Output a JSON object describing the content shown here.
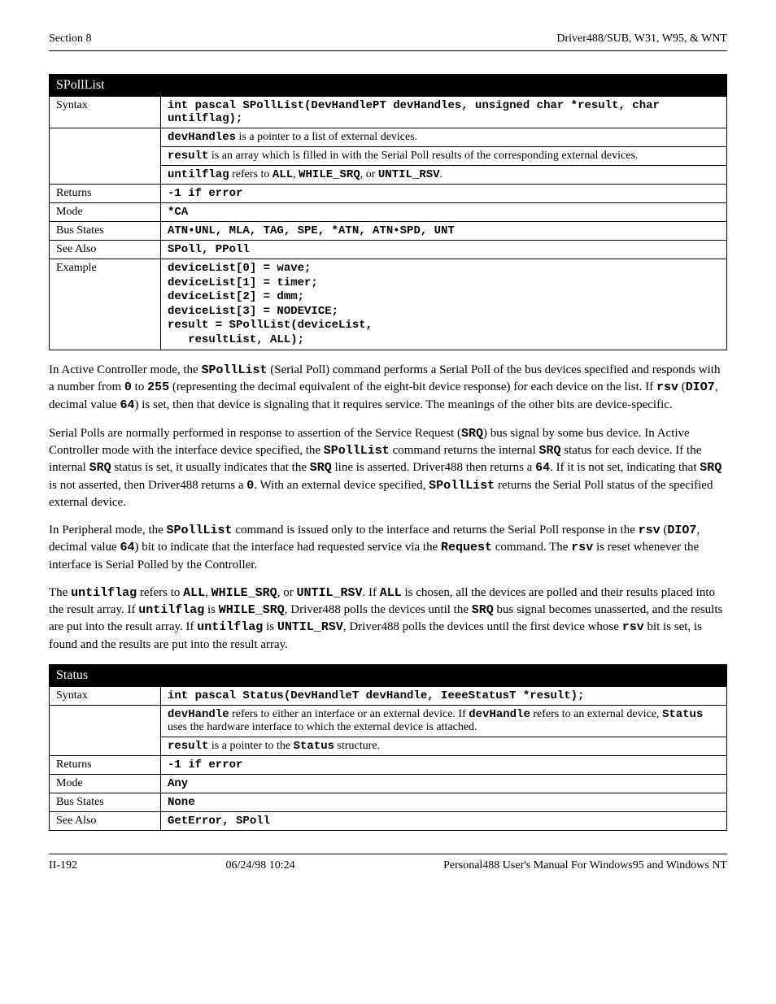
{
  "header": {
    "left": "Section 8",
    "right": "Driver488/SUB, W31, W95, & WNT"
  },
  "table1": {
    "title": "SPollList",
    "rows": {
      "syntax_label": "Syntax",
      "syntax_val": "int pascal SPollList(DevHandlePT devHandles, unsigned char *result, char untilflag);",
      "devh_label": "devHandles",
      "devh_after": " is a pointer to a list of external devices.",
      "result_label": "result",
      "result_after": " is an array which is filled in with the Serial Poll results of the corresponding external devices.",
      "until_label": "untilflag",
      "until_mid": " refers to ",
      "until_mono1": "ALL",
      "until_sep1": ", ",
      "until_mono2": "WHILE_SRQ",
      "until_sep2": ", or ",
      "until_mono3": "UNTIL_RSV",
      "until_end": ".",
      "returns_label": "Returns",
      "returns_val": "-1 if error",
      "mode_label": "Mode",
      "mode_val": "*CA",
      "bus_label": "Bus States",
      "bus_val": "ATN•UNL, MLA, TAG, SPE, *ATN, ATN•SPD, UNT",
      "see_label": "See Also",
      "see_val": "SPoll, PPoll",
      "ex_label": "Example",
      "ex_code": "deviceList[0] = wave;\ndeviceList[1] = timer;\ndeviceList[2] = dmm;\ndeviceList[3] = NODEVICE;\nresult = SPollList(deviceList,\n   resultList, ALL);"
    }
  },
  "para1": {
    "t1": "In Active Controller mode, the ",
    "m1": "SPollList",
    "t2": " (Serial Poll) command performs a Serial Poll of the bus devices specified and responds with a number from ",
    "m2": "0",
    "t3": " to ",
    "m3": "255",
    "t4": " (representing the decimal equivalent of the eight-bit device response) for each device on the list. If ",
    "m4": "rsv",
    "t5": " (",
    "m5": "DIO7",
    "t6": ", decimal value ",
    "m6": "64",
    "t7": ") is set, then that device is signaling that it requires service. The meanings of the other bits are device-specific."
  },
  "para2": {
    "t1": "Serial Polls are normally performed in response to assertion of the Service Request (",
    "m1": "SRQ",
    "t2": ") bus signal by some bus device. In Active Controller mode with the interface device specified, the ",
    "m2": "SPollList",
    "t3": " command returns the internal ",
    "m3": "SRQ",
    "t4": " status for each device. If the internal ",
    "m4": "SRQ",
    "t5": " status is set, it usually indicates that the ",
    "m5": "SRQ",
    "t6": " line is asserted. Driver488 then returns a ",
    "m6": "64",
    "t7": ". If it is not set, indicating that ",
    "m7": "SRQ",
    "t8": " is not asserted, then Driver488 returns a ",
    "m8": "0",
    "t9": ". With an external device specified, ",
    "m9": "SPollList",
    "t10": " returns the Serial Poll status of the specified external device."
  },
  "para3": {
    "t1": "In Peripheral mode, the ",
    "m1": "SPollList",
    "t2": " command is issued only to the interface and returns the Serial Poll response in the ",
    "m2": "rsv",
    "t3": " (",
    "m3": "DIO7",
    "t4": ", decimal value ",
    "m4": "64",
    "t5": ") bit to indicate that the interface had requested service via the ",
    "m5": "Request",
    "t6": " command. The ",
    "m6": "rsv",
    "t7": " is reset whenever the interface is Serial Polled by the Controller."
  },
  "para4": {
    "t1": "The ",
    "m1": "untilflag",
    "t2": " refers to ",
    "m2": "ALL",
    "t3": ", ",
    "m3": "WHILE_SRQ",
    "t4": ", or ",
    "m4": "UNTIL_RSV",
    "t5": ". If ",
    "m5": "ALL",
    "t6": " is chosen, all the devices are polled and their results placed into the result array. If ",
    "m6": "untilflag",
    "t7": " is ",
    "m7": "WHILE_SRQ",
    "t8": ", Driver488 polls the devices until the ",
    "m8": "SRQ",
    "t9": " bus signal becomes unasserted, and the results are put into the result array. If ",
    "m9": "untilflag",
    "t10": " is ",
    "m10": "UNTIL_RSV",
    "t11": ", Driver488 polls the devices until the first device whose ",
    "m11": "rsv",
    "t12": " bit is set, is found and the results are put into the result array."
  },
  "table2": {
    "title": "Status",
    "rows": {
      "syntax_label": "Syntax",
      "syntax_val": "int pascal Status(DevHandleT devHandle, IeeeStatusT *result);",
      "devh_label": "devHandle",
      "devh_after": " refers to either an interface or an external device. If ",
      "devh_mono2": "devHandle",
      "devh_mid": " refers to an external device, ",
      "devh_mono3": "Status",
      "devh_after2": " uses the hardware interface to which the external device is attached.",
      "result_label": "result",
      "result_mid": " is a pointer to the ",
      "result_mono": "Status",
      "result_after": " structure.",
      "returns_label": "Returns",
      "returns_val": "-1 if error",
      "mode_label": "Mode",
      "mode_val": "Any",
      "bus_label": "Bus States",
      "bus_val": "None",
      "see_label": "See Also",
      "see_val": "GetError, SPoll"
    }
  },
  "footer": {
    "left": "II-192",
    "center": "06/24/98 10:24",
    "right": "Personal488 User's Manual For Windows95 and Windows NT"
  }
}
